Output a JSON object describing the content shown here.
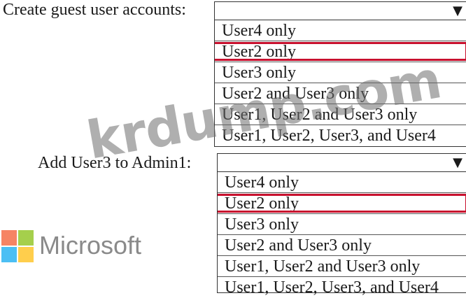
{
  "question1": {
    "label": "Create guest user accounts:",
    "arrow": "▼",
    "options": [
      "User4 only",
      "User2 only",
      "User3 only",
      "User2 and User3 only",
      "User1, User2 and User3 only",
      "User1, User2, User3, and User4"
    ],
    "selected_index": 1
  },
  "question2": {
    "label": "Add User3 to Admin1:",
    "arrow": "▼",
    "options": [
      "User4 only",
      "User2 only",
      "User3 only",
      "User2 and User3 only",
      "User1, User2 and User3 only",
      "User1, User2, User3, and User4"
    ],
    "selected_index": 1
  },
  "watermark": "krdump.com",
  "brand": {
    "name": "Microsoft",
    "logo_colors": [
      "#f25022",
      "#7fba00",
      "#00a4ef",
      "#ffb900"
    ]
  },
  "colors": {
    "selection_border": "#c8102e"
  }
}
